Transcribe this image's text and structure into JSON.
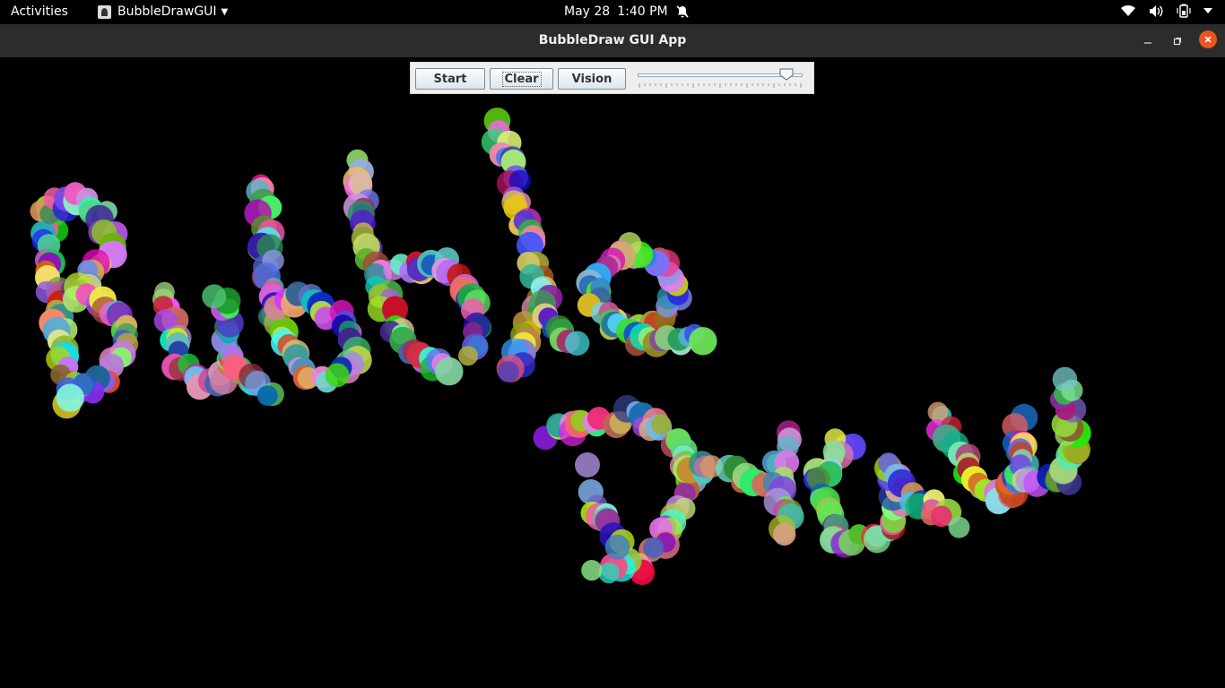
{
  "topbar": {
    "activities": "Activities",
    "app_menu": "BubbleDrawGUI",
    "date": "May 28",
    "time": "1:40 PM",
    "icons": [
      "notifications-off-icon",
      "wifi-icon",
      "volume-icon",
      "battery-icon",
      "chevron-down-icon"
    ]
  },
  "window": {
    "title": "BubbleDraw GUI App"
  },
  "toolbar": {
    "start_label": "Start",
    "clear_label": "Clear",
    "vision_label": "Vision",
    "slider_value": 0.9
  },
  "colors": {
    "canvas_bg": "#000000",
    "accent_close": "#e95420"
  }
}
